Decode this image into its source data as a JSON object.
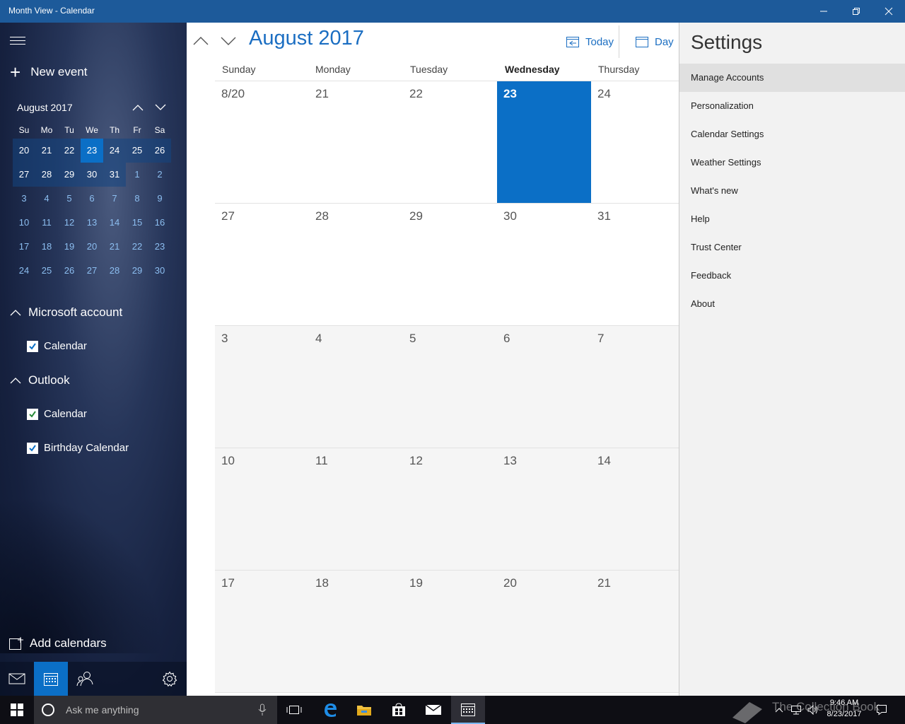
{
  "window": {
    "title": "Month View - Calendar"
  },
  "sidebar": {
    "new_event": "New event",
    "mini_calendar": {
      "title": "August 2017",
      "dow": [
        "Su",
        "Mo",
        "Tu",
        "We",
        "Th",
        "Fr",
        "Sa"
      ],
      "weeks": [
        [
          "20",
          "21",
          "22",
          "23",
          "24",
          "25",
          "26"
        ],
        [
          "27",
          "28",
          "29",
          "30",
          "31",
          "1",
          "2"
        ],
        [
          "3",
          "4",
          "5",
          "6",
          "7",
          "8",
          "9"
        ],
        [
          "10",
          "11",
          "12",
          "13",
          "14",
          "15",
          "16"
        ],
        [
          "17",
          "18",
          "19",
          "20",
          "21",
          "22",
          "23"
        ],
        [
          "24",
          "25",
          "26",
          "27",
          "28",
          "29",
          "30"
        ]
      ]
    },
    "accounts": [
      {
        "name": "Microsoft account",
        "calendars": [
          "Calendar"
        ]
      },
      {
        "name": "Outlook",
        "calendars": [
          "Calendar",
          "Birthday Calendar"
        ]
      }
    ],
    "add_calendars": "Add calendars"
  },
  "main": {
    "month_title": "August 2017",
    "today_label": "Today",
    "view_label": "Day",
    "columns": [
      "Sunday",
      "Monday",
      "Tuesday",
      "Wednesday",
      "Thursday"
    ],
    "weeks": [
      [
        "8/20",
        "21",
        "22",
        "23",
        "24"
      ],
      [
        "27",
        "28",
        "29",
        "30",
        "31"
      ],
      [
        "3",
        "4",
        "5",
        "6",
        "7"
      ],
      [
        "10",
        "11",
        "12",
        "13",
        "14"
      ],
      [
        "17",
        "18",
        "19",
        "20",
        "21"
      ]
    ]
  },
  "settings": {
    "title": "Settings",
    "items": [
      "Manage Accounts",
      "Personalization",
      "Calendar Settings",
      "Weather Settings",
      "What's new",
      "Help",
      "Trust Center",
      "Feedback",
      "About"
    ]
  },
  "taskbar": {
    "search_placeholder": "Ask me anything",
    "time": "9:46 AM",
    "date": "8/23/2017"
  },
  "watermark": "The Collection Book",
  "colors": {
    "accent": "#0b6fc6",
    "titlebar": "#1d5a9a",
    "link": "#1b6ec2"
  }
}
